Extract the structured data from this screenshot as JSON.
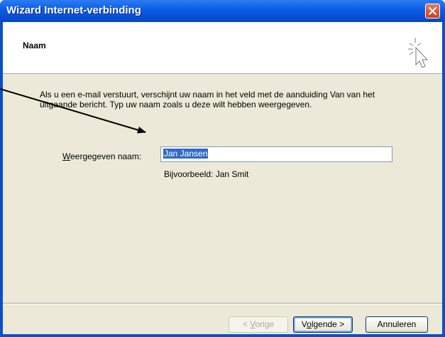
{
  "window": {
    "title": "Wizard Internet-verbinding"
  },
  "header": {
    "page_title": "Naam"
  },
  "body": {
    "intro": "Als u een e-mail verstuurt, verschijnt uw naam in het veld met de aanduiding Van van het uitgaande bericht. Typ uw naam zoals u deze wilt hebben weergegeven.",
    "display_name_label_accel": "W",
    "display_name_label_rest": "eergegeven naam:",
    "display_name_value": "Jan Jansen",
    "example": "Bijvoorbeeld: Jan Smit"
  },
  "buttons": {
    "back_prefix": "< ",
    "back_accel": "V",
    "back_rest": "orige",
    "next_prefix": "V",
    "next_accel": "o",
    "next_rest": "lgende >",
    "cancel": "Annuleren"
  },
  "colors": {
    "titlebar": "#0a50c8",
    "client": "#ece9d8",
    "selection": "#316ac5",
    "close_button": "#c8401d"
  }
}
